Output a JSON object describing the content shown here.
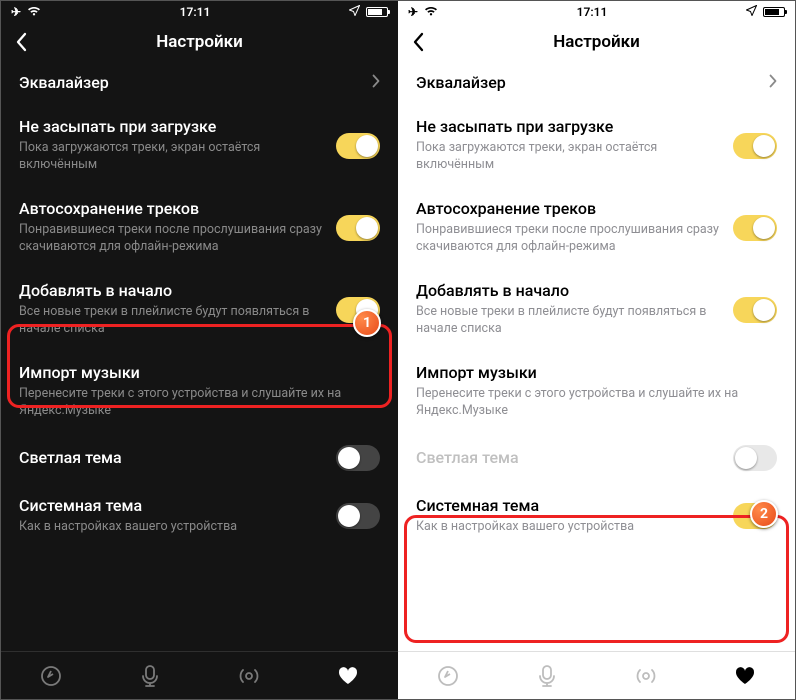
{
  "statusbar": {
    "time": "17:11"
  },
  "header": {
    "title": "Настройки"
  },
  "rows": {
    "equalizer": {
      "title": "Эквалайзер"
    },
    "keepawake": {
      "title": "Не засыпать при загрузке",
      "sub": "Пока загружаются треки, экран остаётся включённым"
    },
    "autosave": {
      "title": "Автосохранение треков",
      "sub": "Понравившиеся треки после прослушивания сразу скачиваются для офлайн-режима"
    },
    "addtop": {
      "title": "Добавлять в начало",
      "sub": "Все новые треки в плейлисте будут появляться в начале списка"
    },
    "import": {
      "title": "Импорт музыки",
      "sub": "Перенесите треки с этого устройства и слушайте их на Яндекс.Музыке"
    },
    "lighttheme": {
      "title": "Светлая тема"
    },
    "systemtheme": {
      "title": "Системная тема",
      "sub": "Как в настройках вашего устройства"
    }
  },
  "badges": {
    "one": "1",
    "two": "2"
  },
  "toggles": {
    "dark": {
      "keepawake": true,
      "autosave": true,
      "addtop": true,
      "lighttheme": false,
      "systemtheme": false
    },
    "light": {
      "keepawake": true,
      "autosave": true,
      "addtop": true,
      "lighttheme": false,
      "systemtheme": true
    }
  }
}
